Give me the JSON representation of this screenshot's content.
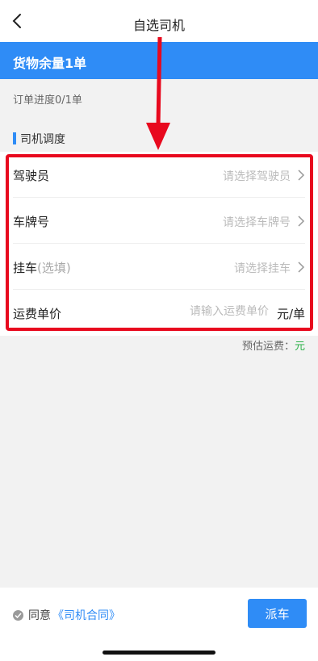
{
  "nav": {
    "title": "自选司机",
    "back_icon": "chevron-left-icon"
  },
  "cargo": {
    "label": "货物余量1单"
  },
  "order": {
    "progress": "订单进度0/1单"
  },
  "section": {
    "title": "司机调度"
  },
  "form": {
    "driver": {
      "label": "驾驶员",
      "placeholder": "请选择驾驶员"
    },
    "plate": {
      "label": "车牌号",
      "placeholder": "请选择车牌号"
    },
    "trailer": {
      "label": "挂车",
      "optional": "(选填)",
      "placeholder": "请选择挂车"
    },
    "price": {
      "label": "运费单价",
      "placeholder": "请输入运费单价",
      "unit": "元/单"
    }
  },
  "estimate": {
    "label": "预估运费：",
    "unit": "元"
  },
  "footer": {
    "agree_label": "同意",
    "contract_link": "《司机合同》",
    "dispatch_button": "派车"
  },
  "colors": {
    "accent": "#2f8cf6",
    "highlight": "#e8091e",
    "money": "#2eb34b"
  }
}
